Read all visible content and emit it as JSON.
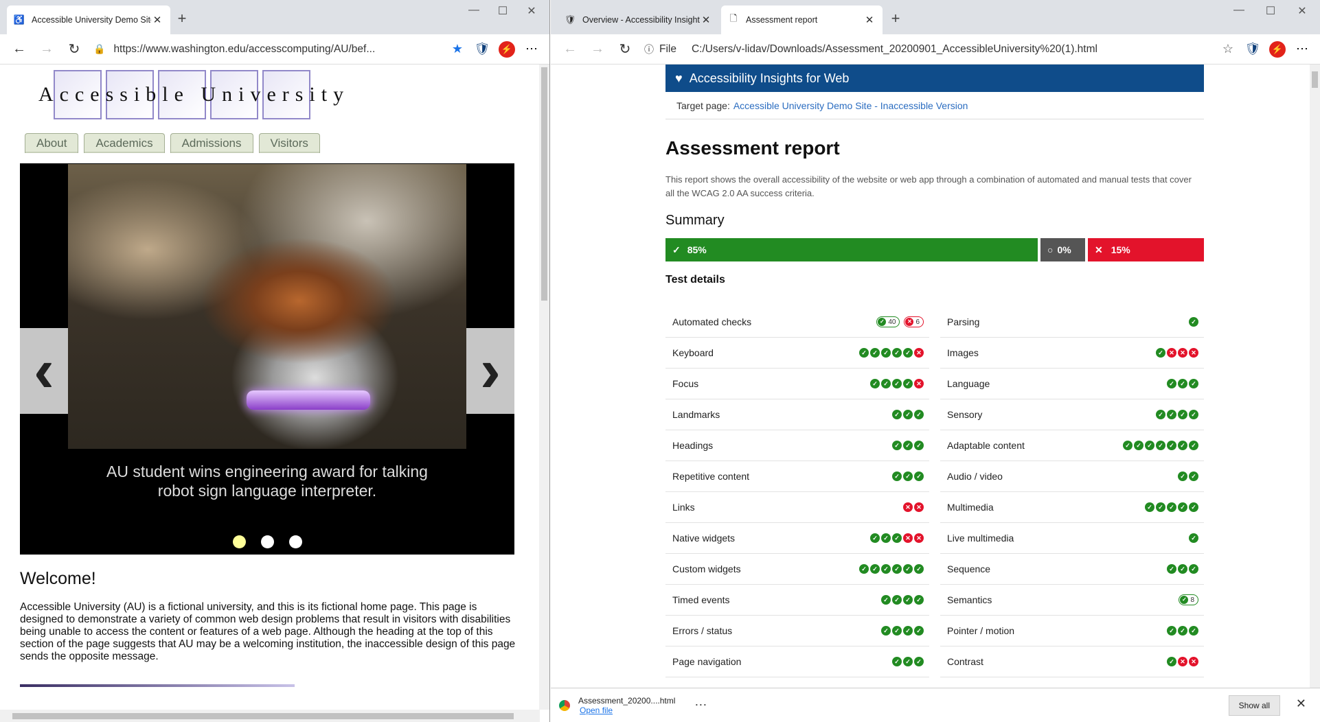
{
  "left": {
    "tab_title": "Accessible University Demo Site",
    "tab_icon": "accessibility-icon",
    "url": "https://www.washington.edu/accesscomputing/AU/bef...",
    "logo_text": "Accessible University",
    "nav": [
      "About",
      "Academics",
      "Admissions",
      "Visitors"
    ],
    "slide_caption": "AU student wins engineering award for talking robot sign language interpreter.",
    "welcome": "Welcome!",
    "paragraph": "Accessible University (AU) is a fictional university, and this is its fictional home page. This page is designed to demonstrate a variety of common web design problems that result in visitors with disabilities being unable to access the content or features of a web page. Although the heading at the top of this section of the page suggests that AU may be a welcoming institution, the inaccessible design of this page sends the opposite message."
  },
  "right": {
    "tabs": [
      "Overview - Accessibility Insights",
      "Assessment report"
    ],
    "file_label": "File",
    "url": "C:/Users/v-lidav/Downloads/Assessment_20200901_AccessibleUniversity%20(1).html",
    "banner": "Accessibility Insights for Web",
    "target_label": "Target page:",
    "target_link": "Accessible University Demo Site - Inaccessible Version",
    "title": "Assessment report",
    "description": "This report shows the overall accessibility of the website or web app through a combination of automated and manual tests that cover all the WCAG 2.0 AA success criteria.",
    "summary_heading": "Summary",
    "summary": {
      "pass": "85%",
      "incomplete": "0%",
      "fail": "15%"
    },
    "test_details_heading": "Test details",
    "tests": [
      {
        "name": "Automated checks",
        "pass_count": "40",
        "fail_count": "6"
      },
      {
        "name": "Parsing",
        "icons": "p"
      },
      {
        "name": "Keyboard",
        "icons": "pppppf"
      },
      {
        "name": "Images",
        "icons": "pfff"
      },
      {
        "name": "Focus",
        "icons": "ppppf"
      },
      {
        "name": "Language",
        "icons": "ppp"
      },
      {
        "name": "Landmarks",
        "icons": "ppp"
      },
      {
        "name": "Sensory",
        "icons": "pppp"
      },
      {
        "name": "Headings",
        "icons": "ppp"
      },
      {
        "name": "Adaptable content",
        "icons": "ppppppp"
      },
      {
        "name": "Repetitive content",
        "icons": "ppp"
      },
      {
        "name": "Audio / video",
        "icons": "pp"
      },
      {
        "name": "Links",
        "icons": "ff"
      },
      {
        "name": "Multimedia",
        "icons": "ppppp"
      },
      {
        "name": "Native widgets",
        "icons": "pppff"
      },
      {
        "name": "Live multimedia",
        "icons": "p"
      },
      {
        "name": "Custom widgets",
        "icons": "pppppp"
      },
      {
        "name": "Sequence",
        "icons": "ppp"
      },
      {
        "name": "Timed events",
        "icons": "pppp"
      },
      {
        "name": "Semantics",
        "pass_count": "8"
      },
      {
        "name": "Errors / status",
        "icons": "pppp"
      },
      {
        "name": "Pointer / motion",
        "icons": "ppp"
      },
      {
        "name": "Page navigation",
        "icons": "ppp"
      },
      {
        "name": "Contrast",
        "icons": "pff"
      }
    ],
    "download": {
      "filename": "Assessment_20200....html",
      "open_label": "Open file",
      "show_all": "Show all"
    }
  },
  "colors": {
    "pass": "#228b22",
    "fail": "#e3132b",
    "incomplete": "#555555",
    "banner": "#0f4c8a"
  }
}
